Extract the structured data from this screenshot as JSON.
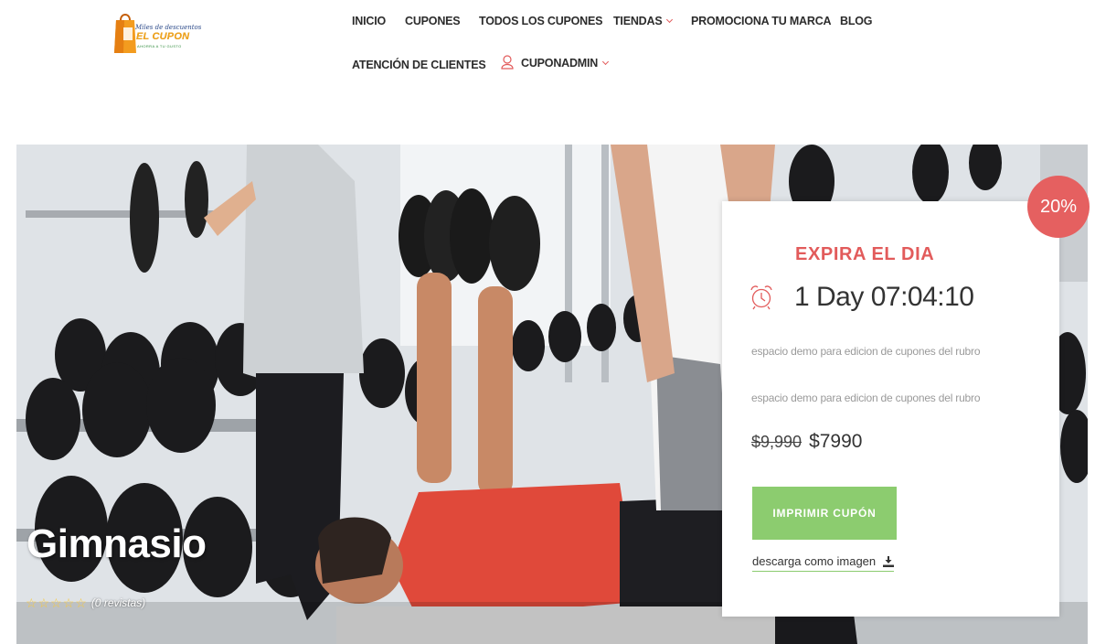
{
  "logo": {
    "tagline": "Miles de descuentos",
    "brand": "EL CUPON",
    "sub": "AHORRA A TU GUSTO"
  },
  "nav": {
    "items": [
      {
        "label": "INICIO"
      },
      {
        "label": "CUPONES"
      },
      {
        "label": "TODOS LOS CUPONES"
      },
      {
        "label": "TIENDAS"
      },
      {
        "label": "PROMOCIONA TU MARCA"
      },
      {
        "label": "BLOG"
      },
      {
        "label": "ATENCIÓN DE CLIENTES"
      },
      {
        "label": "CUPONADMIN"
      }
    ]
  },
  "hero": {
    "title": "Gimnasio",
    "rating": {
      "stars": 0,
      "max": 5,
      "reviews_text": "(0 revistas)"
    }
  },
  "coupon": {
    "discount_badge": "20%",
    "expires_label": "EXPIRA EL DIA",
    "countdown": "1 Day 07:04:10",
    "description_1": "espacio demo para edicion de cupones del rubro",
    "description_2": "espacio demo para edicion de cupones del rubro",
    "old_price": "$9,990",
    "new_price": "$7990",
    "print_button": "IMPRIMIR CUPÓN",
    "download_link": "descarga como imagen"
  },
  "colors": {
    "accent_red": "#e25b5b",
    "badge_red": "#e56060",
    "button_green": "#8ccc6f",
    "star_yellow": "#f7c940"
  }
}
